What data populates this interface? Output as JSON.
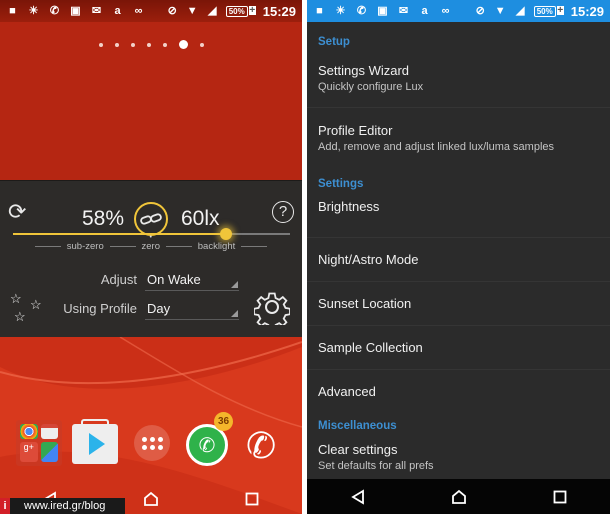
{
  "status_bar": {
    "left_icons": [
      "chat-bubble-icon",
      "brightness-icon",
      "whatsapp-icon",
      "image-icon",
      "mail-icon",
      "amazon-icon",
      "link-icon"
    ],
    "right_icons": [
      "do-not-disturb-icon",
      "wifi-icon",
      "signal-icon"
    ],
    "battery": "50%",
    "time": "15:29"
  },
  "home": {
    "page_count": 7,
    "active_page": 6,
    "lux_widget": {
      "brightness": "58%",
      "lux": "60lx",
      "slider_percent": 77,
      "scale_labels": [
        "sub-zero",
        "zero",
        "backlight"
      ],
      "adjust_label": "Adjust",
      "adjust_value": "On Wake",
      "profile_label": "Using Profile",
      "profile_value": "Day"
    },
    "dock": {
      "folder_apps": [
        "Chrome",
        "Gmail",
        "Google+",
        "Maps"
      ],
      "apps": [
        "Play Store",
        "App Drawer",
        "WhatsApp",
        "Phone"
      ],
      "whatsapp_badge": "36"
    },
    "watermark": {
      "letter": "i",
      "text": "www.ired.gr/blog"
    }
  },
  "settings": {
    "sections": [
      {
        "header": "Setup",
        "items": [
          {
            "title": "Settings Wizard",
            "subtitle": "Quickly configure Lux"
          },
          {
            "title": "Profile Editor",
            "subtitle": "Add, remove and adjust linked lux/luma samples"
          }
        ]
      },
      {
        "header": "Settings",
        "items": [
          {
            "title": "Brightness"
          },
          {
            "title": "Night/Astro Mode"
          },
          {
            "title": "Sunset Location"
          },
          {
            "title": "Sample Collection"
          },
          {
            "title": "Advanced"
          }
        ]
      },
      {
        "header": "Miscellaneous",
        "items": [
          {
            "title": "Clear settings",
            "subtitle": "Set defaults for all prefs"
          }
        ]
      }
    ]
  },
  "colors": {
    "accent_blue": "#1e8ee0",
    "section_header": "#3d8fd1",
    "slider_yellow": "#f0c53a",
    "wallpaper_red": "#b52612"
  }
}
